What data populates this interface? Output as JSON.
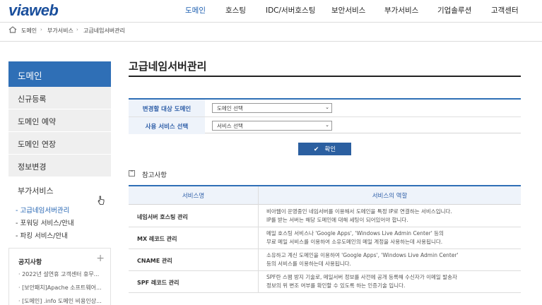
{
  "header": {
    "logo": "viaweb",
    "nav": [
      {
        "label": "도메인",
        "active": true
      },
      {
        "label": "호스팅",
        "active": false
      },
      {
        "label": "IDC/서버호스팅",
        "active": false
      },
      {
        "label": "보안서비스",
        "active": false
      },
      {
        "label": "부가서비스",
        "active": false
      },
      {
        "label": "기업솔루션",
        "active": false
      },
      {
        "label": "고객센터",
        "active": false
      }
    ]
  },
  "breadcrumb": [
    "도메인",
    "부가서비스",
    "고급네임서버관리"
  ],
  "sidebar": {
    "title": "도메인",
    "items": [
      "신규등록",
      "도메인 예약",
      "도메인 연장",
      "정보변경",
      "부가서비스"
    ],
    "sub_items": [
      "- 고급네임서버관리",
      "- 포워딩 서비스/안내",
      "- 파킹 서비스/안내"
    ],
    "notice": {
      "title": "공지사항",
      "plus": "+",
      "items": [
        "· 2022년 설연휴 고객센터 휴무...",
        "· [보안패치]Apache 소프트웨어...",
        "· [도메인] .info 도메인 비용인상..."
      ]
    }
  },
  "main": {
    "title": "고급네임서버관리",
    "form": {
      "rows": [
        {
          "label": "변경할 대상 도메인",
          "value": "도메인 선택"
        },
        {
          "label": "사용 서비스 선택",
          "value": "서비스 선택"
        }
      ],
      "confirm": "확인"
    },
    "reference": {
      "title": "참고사항",
      "toggle": "^",
      "columns": [
        "서비스명",
        "서비스의 역할"
      ],
      "rows": [
        {
          "name": "네임서버 호스팅 관리",
          "desc": [
            "비아웹이 운영중인 네임서버를 이용해서 도메인을 특정 IP로 연결하는 서비스입니다.",
            "IP를 받는 서버는 해당 도메인에 대해 세팅이 되어있어야 합니다."
          ]
        },
        {
          "name": "MX 레코드 관리",
          "desc": [
            "메일 호스팅 서비스나 'Google Apps', 'Windows Live Admin Center' 등의",
            "무료 메일 서비스를 이용하여 소유도메인의 메일 계정을 사용하는데 사용됩니다."
          ]
        },
        {
          "name": "CNAME 관리",
          "desc": [
            "소유하고 계신 도메인을 이용하여 'Google Apps', 'Windows Live Admin Center'",
            "등의 서비스를 이용하는데 사용됩니다."
          ]
        },
        {
          "name": "SPF 레코드 관리",
          "desc": [
            "SPF란 스팸 방지 기술로, 메일서버 정보를 사전에 공개 등록해 수신자가 이메일 발송자",
            "정보의 위 변조 여부를 확인할 수 있도록 하는 인증기술 입니다."
          ]
        }
      ]
    }
  },
  "colors": {
    "brand": "#1a4f9c",
    "accent": "#2f6fb6",
    "button": "#2b5fa0"
  }
}
